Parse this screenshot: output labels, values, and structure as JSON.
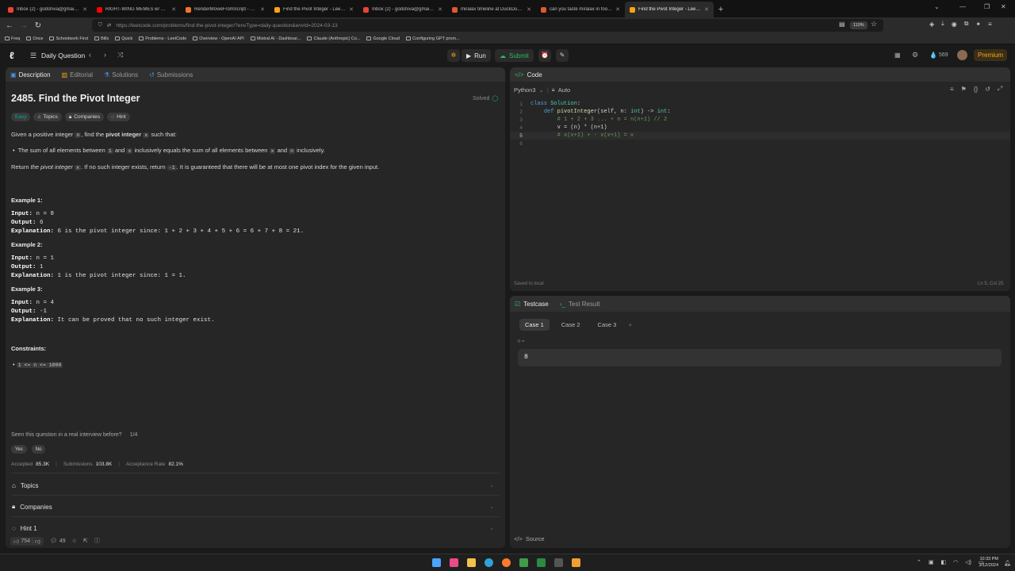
{
  "browser": {
    "tabs": [
      {
        "title": "Inbox (2) - godshiva@gmail.com",
        "color": "#ea4335",
        "active": false
      },
      {
        "title": "RIGHT-WING MEMES w/ PAUL",
        "color": "#ff0000",
        "active": false
      },
      {
        "title": "RenderMovieFromScript - Jupyter",
        "color": "#f37726",
        "active": false
      },
      {
        "title": "Find the Pivot Integer - LeetCode",
        "color": "#ffa116",
        "active": false
      },
      {
        "title": "Inbox (2) - godshiva@gmail.com",
        "color": "#ea4335",
        "active": false
      },
      {
        "title": "miralax timeline at DuckDuckGo",
        "color": "#de5833",
        "active": false
      },
      {
        "title": "can you taste miralax in food?",
        "color": "#de5833",
        "active": false
      },
      {
        "title": "Find the Pivot Integer - LeetCode",
        "color": "#ffa116",
        "active": true
      }
    ],
    "url": "https://leetcode.com/problems/find-the-pivot-integer/?envType=daily-question&envId=2024-03-13",
    "zoom": "110%",
    "bookmarks": [
      "Freq",
      "Once",
      "Schoolwork First",
      "Bills",
      "Quick",
      "Problems - LeetCode",
      "Overview - OpenAI API",
      "Mistral AI - Dashboar...",
      "Claude (Anthropic) Co...",
      "Google Cloud",
      "Configuring GPT prom..."
    ]
  },
  "lc_header": {
    "daily_label": "Daily Question",
    "run_label": "Run",
    "submit_label": "Submit",
    "coins": "569",
    "premium_label": "Premium"
  },
  "left_tabs": [
    "Description",
    "Editorial",
    "Solutions",
    "Submissions"
  ],
  "problem": {
    "title": "2485. Find the Pivot Integer",
    "status": "Solved",
    "difficulty": "Easy",
    "pills": [
      "Topics",
      "Companies",
      "Hint"
    ],
    "stmt_a": "Given a positive integer",
    "stmt_n": "n",
    "stmt_b": ", find the",
    "stmt_bold": "pivot integer",
    "stmt_x": "x",
    "stmt_c": "such that:",
    "bullet_a": "The sum of all elements between",
    "bullet_1": "1",
    "bullet_b": "and",
    "bullet_x": "x",
    "bullet_c": "inclusively equals the sum of all elements between",
    "bullet_x2": "x",
    "bullet_d": "and",
    "bullet_n": "n",
    "bullet_e": "inclusively.",
    "ret_a": "Return",
    "ret_it": "the pivot integer",
    "ret_x": "x",
    "ret_b": ". If no such integer exists, return",
    "ret_m1": "-1",
    "ret_c": ". It is guaranteed that there will be at most one pivot index for the given input.",
    "examples": [
      {
        "title": "Example 1:",
        "input": "n = 8",
        "output": "6",
        "explanation": "6 is the pivot integer since: 1 + 2 + 3 + 4 + 5 + 6 = 6 + 7 + 8 = 21."
      },
      {
        "title": "Example 2:",
        "input": "n = 1",
        "output": "1",
        "explanation": "1 is the pivot integer since: 1 = 1."
      },
      {
        "title": "Example 3:",
        "input": "n = 4",
        "output": "-1",
        "explanation": "It can be proved that no such integer exist."
      }
    ],
    "labels": {
      "input": "Input:",
      "output": "Output:",
      "explanation": "Explanation:"
    },
    "constraints_title": "Constraints:",
    "constraint": "1 <= n <= 1000",
    "interview_q": "Seen this question in a real interview before?",
    "interview_count": "1/4",
    "yes": "Yes",
    "no": "No",
    "accepted_label": "Accepted",
    "accepted": "85.3K",
    "submissions_label": "Submissions",
    "submissions": "103.8K",
    "rate_label": "Acceptance Rate",
    "rate": "82.1%",
    "accordions": [
      "Topics",
      "Companies",
      "Hint 1"
    ],
    "likes": "754",
    "comments": "49"
  },
  "code_panel": {
    "title": "Code",
    "language": "Python3",
    "mode": "Auto",
    "saved": "Saved to local",
    "cursor": "Ln 5, Col 25"
  },
  "test_panel": {
    "tabs": [
      "Testcase",
      "Test Result"
    ],
    "cases": [
      "Case 1",
      "Case 2",
      "Case 3"
    ],
    "var_label": "n =",
    "var_value": "8",
    "source": "Source"
  },
  "taskbar": {
    "time": "10:33 PM",
    "date": "3/12/2024"
  }
}
